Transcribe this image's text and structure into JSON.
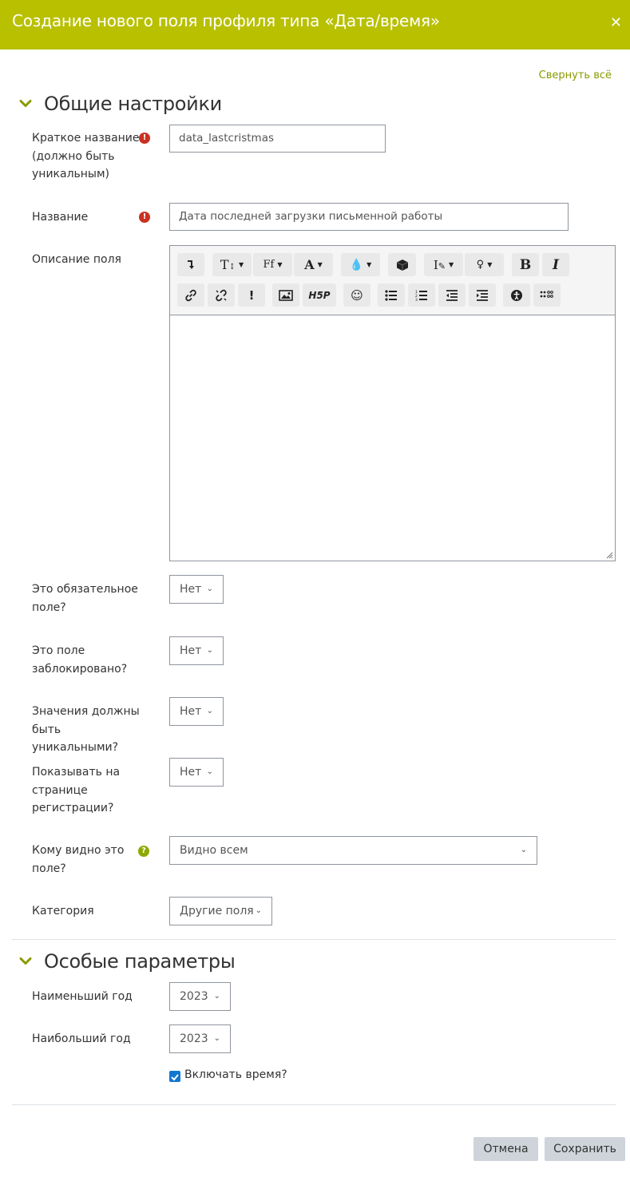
{
  "header": {
    "title": "Создание нового поля профиля типа «Дата/время»",
    "close_icon": "close-icon"
  },
  "collapse_all": "Свернуть всё",
  "sections": {
    "general": {
      "title": "Общие настройки"
    },
    "specific": {
      "title": "Особые параметры"
    }
  },
  "fields": {
    "shortname": {
      "label": "Краткое название (должно быть уникальным)",
      "value": "data_lastcristmas"
    },
    "name": {
      "label": "Название",
      "value": "Дата последней загрузки письменной работы"
    },
    "description": {
      "label": "Описание поля"
    },
    "required": {
      "label": "Это обязательное поле?",
      "value": "Нет"
    },
    "locked": {
      "label": "Это поле заблокировано?",
      "value": "Нет"
    },
    "unique": {
      "label": "Значения должны быть уникальными?",
      "value": "Нет"
    },
    "signup": {
      "label": "Показывать на странице регистрации?",
      "value": "Нет"
    },
    "visible": {
      "label": "Кому видно это поле?",
      "value": "Видно всем"
    },
    "category": {
      "label": "Категория",
      "value": "Другие поля"
    },
    "startyear": {
      "label": "Наименьший год",
      "value": "2023"
    },
    "endyear": {
      "label": "Наибольший год",
      "value": "2023"
    },
    "includetime": {
      "label": "Включать время?",
      "checked": true
    }
  },
  "toolbar_icons": [
    "show-more-icon",
    "text-size-icon",
    "font-family-icon",
    "font-color-icon",
    "highlight-icon",
    "cube-icon",
    "style-icon",
    "lightbulb-icon",
    "bold-icon",
    "italic-icon",
    "link-icon",
    "unlink-icon",
    "emphasis-icon",
    "image-icon",
    "h5p-icon",
    "emoji-icon",
    "bullet-list-icon",
    "numbered-list-icon",
    "outdent-icon",
    "indent-icon",
    "accessibility-icon",
    "screenreader-icon"
  ],
  "colors": {
    "header": "#b8c000",
    "accent": "#8a9a00",
    "required": "#ca3120",
    "help": "#8fa800",
    "checkbox": "#1177d1"
  },
  "buttons": {
    "cancel": "Отмена",
    "save": "Сохранить"
  }
}
